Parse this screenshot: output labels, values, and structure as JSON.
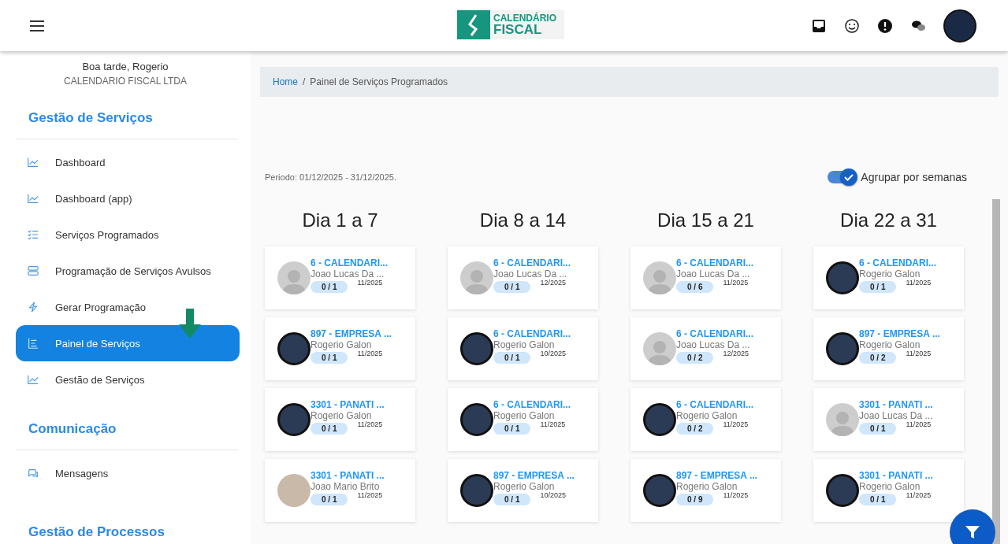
{
  "header": {
    "logo": {
      "line_1": "CALENDÁRIO",
      "line_2": "FISCAL"
    }
  },
  "sidebar": {
    "greeting": "Boa tarde, Rogerio",
    "company": "CALENDARIO FISCAL LTDA",
    "sections": [
      {
        "title": "Gestão de Serviços",
        "items": [
          {
            "label": "Dashboard",
            "kind": "chart",
            "selected": false
          },
          {
            "label": "Dashboard (app)",
            "kind": "chart",
            "selected": false
          },
          {
            "label": "Serviços Programados",
            "kind": "checklist",
            "selected": false
          },
          {
            "label": "Programação de Serviços Avulsos",
            "kind": "layers",
            "selected": false
          },
          {
            "label": "Gerar Programação",
            "kind": "bolt",
            "selected": false
          },
          {
            "label": "Painel de Serviços",
            "kind": "panel",
            "selected": true
          },
          {
            "label": "Gestão de Serviços",
            "kind": "chart",
            "selected": false
          }
        ]
      },
      {
        "title": "Comunicação",
        "items": [
          {
            "label": "Mensagens",
            "kind": "chat",
            "selected": false
          }
        ]
      },
      {
        "title": "Gestão de Processos"
      }
    ]
  },
  "breadcrumb": {
    "separator": "/",
    "items": [
      {
        "label": "Home"
      },
      {
        "label": "Painel de Serviços Programados"
      }
    ]
  },
  "period": "Periodo: 01/12/2025 - 31/12/2025.",
  "group_toggle": {
    "label": "Agrupar por semanas",
    "on": true
  },
  "columns": [
    {
      "title": "Dia 1 a 7",
      "cards": [
        {
          "company": "6 - CALENDARI...",
          "person": "Joao Lucas Da ...",
          "kind": "default",
          "progress": "0 / 1",
          "month": "11/2025"
        },
        {
          "company": "897 - EMPRESA ...",
          "person": "Rogerio Galon",
          "kind": "photo",
          "progress": "0 / 1",
          "month": "11/2025"
        },
        {
          "company": "3301 - PANATI ...",
          "person": "Rogerio Galon",
          "kind": "photo",
          "progress": "0 / 1",
          "month": "11/2025"
        },
        {
          "company": "3301 - PANATI ...",
          "person": "Joao Mario Brito",
          "kind": "photo_light",
          "progress": "0 / 1",
          "month": "11/2025"
        }
      ]
    },
    {
      "title": "Dia 8 a 14",
      "cards": [
        {
          "company": "6 - CALENDARI...",
          "person": "Joao Lucas Da ...",
          "kind": "default",
          "progress": "0 / 1",
          "month": "12/2025"
        },
        {
          "company": "6 - CALENDARI...",
          "person": "Rogerio Galon",
          "kind": "photo",
          "progress": "0 / 1",
          "month": "10/2025"
        },
        {
          "company": "6 - CALENDARI...",
          "person": "Rogerio Galon",
          "kind": "photo",
          "progress": "0 / 1",
          "month": "11/2025"
        },
        {
          "company": "897 - EMPRESA ...",
          "person": "Rogerio Galon",
          "kind": "photo",
          "progress": "0 / 1",
          "month": "10/2025"
        }
      ]
    },
    {
      "title": "Dia 15 a 21",
      "cards": [
        {
          "company": "6 - CALENDARI...",
          "person": "Joao Lucas Da ...",
          "kind": "default",
          "progress": "0 / 6",
          "month": "11/2025"
        },
        {
          "company": "6 - CALENDARI...",
          "person": "Joao Lucas Da ...",
          "kind": "default",
          "progress": "0 / 2",
          "month": "12/2025"
        },
        {
          "company": "6 - CALENDARI...",
          "person": "Rogerio Galon",
          "kind": "photo",
          "progress": "0 / 2",
          "month": "11/2025"
        },
        {
          "company": "897 - EMPRESA ...",
          "person": "Rogerio Galon",
          "kind": "photo",
          "progress": "0 / 9",
          "month": "11/2025"
        }
      ]
    },
    {
      "title": "Dia 22 a 31",
      "cards": [
        {
          "company": "6 - CALENDARI...",
          "person": "Rogerio Galon",
          "kind": "photo",
          "progress": "0 / 1",
          "month": "11/2025"
        },
        {
          "company": "897 - EMPRESA ...",
          "person": "Rogerio Galon",
          "kind": "photo",
          "progress": "0 / 2",
          "month": "11/2025"
        },
        {
          "company": "3301 - PANATI ...",
          "person": "Joao Lucas Da ...",
          "kind": "default",
          "progress": "0 / 1",
          "month": "11/2025"
        },
        {
          "company": "3301 - PANATI ...",
          "person": "Rogerio Galon",
          "kind": "photo",
          "progress": "0 / 1",
          "month": "11/2025"
        }
      ]
    }
  ]
}
